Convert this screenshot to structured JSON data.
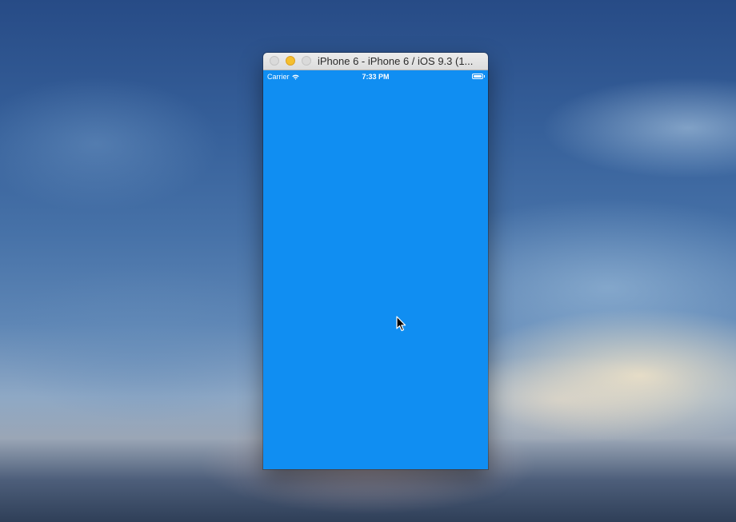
{
  "simulator": {
    "window_title": "iPhone 6 - iPhone 6 / iOS 9.3 (1...",
    "window_buttons": [
      "close",
      "minimize",
      "zoom"
    ],
    "screen_color": "#108ef2"
  },
  "status_bar": {
    "carrier": "Carrier",
    "time": "7:33 PM",
    "battery_level": 1.0
  },
  "icons": {
    "wifi": "wifi-icon",
    "battery": "battery-icon",
    "cursor": "mouse-pointer-icon"
  }
}
